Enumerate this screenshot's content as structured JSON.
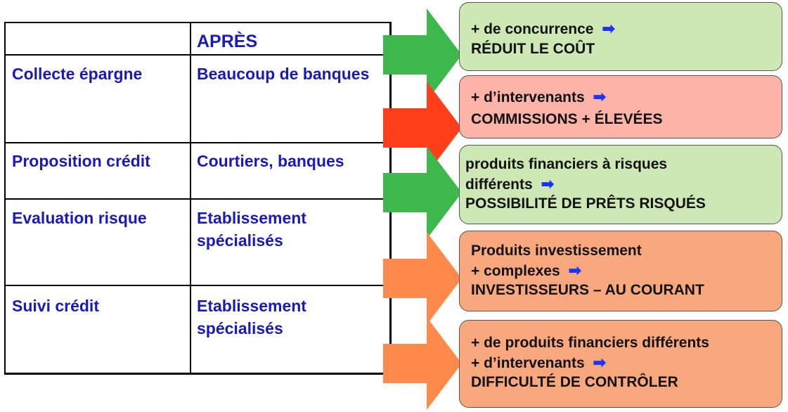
{
  "table": {
    "header": "APRÈS",
    "rows": [
      {
        "left": "Collecte épargne",
        "right": [
          "Beaucoup de banques"
        ]
      },
      {
        "left": "Proposition crédit",
        "right": [
          "Courtiers, banques"
        ]
      },
      {
        "left": "Evaluation risque",
        "right": [
          "Etablissement",
          "spécialisés"
        ]
      },
      {
        "left": "Suivi crédit",
        "right": [
          "Etablissement",
          "spécialisés"
        ]
      }
    ]
  },
  "boxes": [
    {
      "color": "#cde8b4",
      "arrow_color": "#3cb84c",
      "lines": [
        "+ de concurrence",
        "RÉDUIT LE COÛT"
      ],
      "arrow_after_line": 0
    },
    {
      "color": "#fdb3a8",
      "arrow_color": "#ff3e1a",
      "lines": [
        "+ d’intervenants",
        "COMMISSIONS + ÉLEVÉES"
      ],
      "arrow_after_line": 0
    },
    {
      "color": "#cde8b4",
      "arrow_color": "#3cb84c",
      "lines": [
        "produits financiers à risques",
        "différents",
        "POSSIBILITÉ DE PRÊTS RISQUÉS"
      ],
      "arrow_after_line": 1
    },
    {
      "color": "#f9a87e",
      "arrow_color": "#ff8a4a",
      "lines": [
        "Produits investissement",
        "+ complexes",
        "INVESTISSEURS – AU COURANT"
      ],
      "arrow_after_line": 1
    },
    {
      "color": "#f9a87e",
      "arrow_color": "#ff8a4a",
      "lines": [
        "+ de produits financiers différents",
        "+ d’intervenants",
        "DIFFICULTÉ DE CONTRÔLER"
      ],
      "arrow_after_line": 1
    }
  ],
  "icons": {
    "link_arrow": "➡"
  }
}
